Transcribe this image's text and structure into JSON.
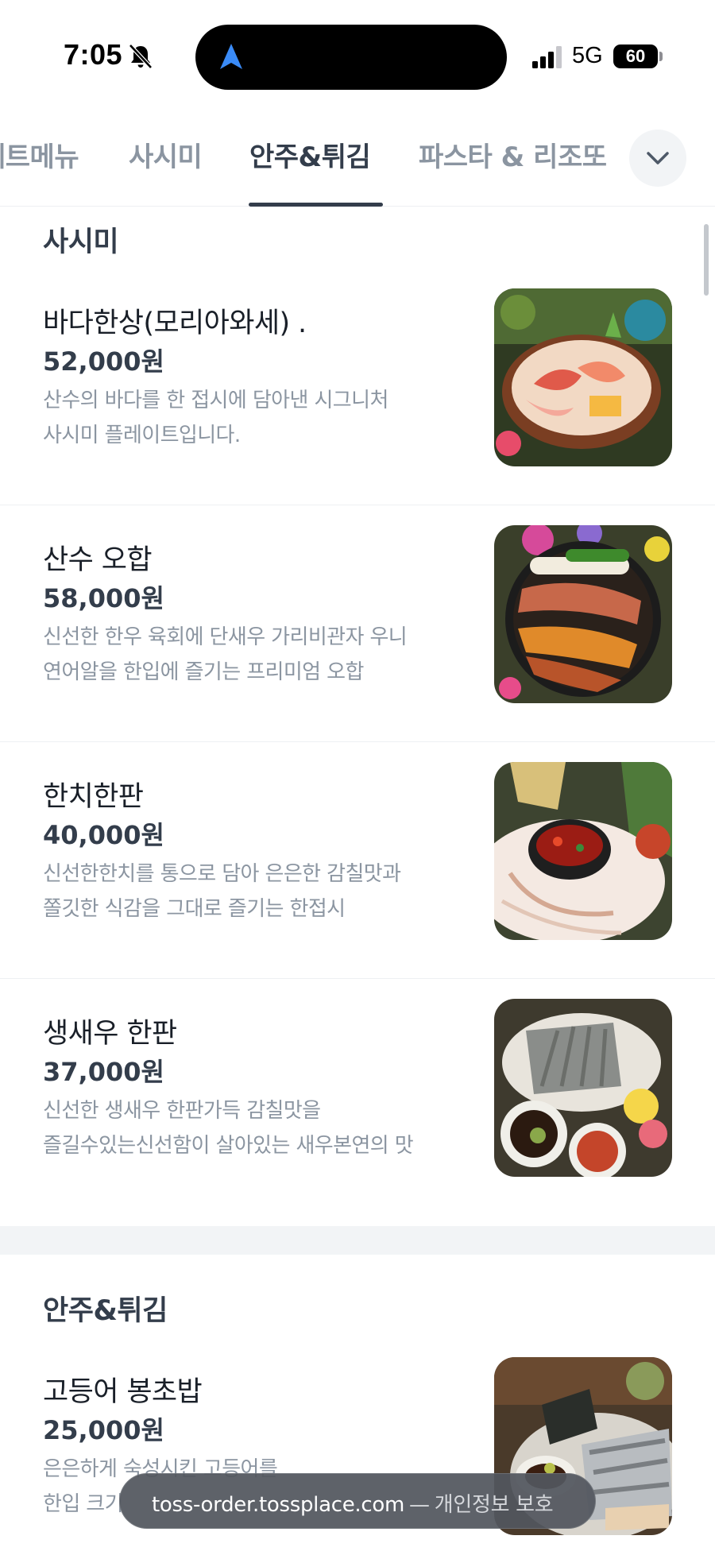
{
  "status_bar": {
    "time": "7:05",
    "network": "5G",
    "battery": "60",
    "icons": [
      "bell-slash-icon",
      "navigation-arrow-icon",
      "signal-icon",
      "battery-icon"
    ]
  },
  "tabs": {
    "items": [
      {
        "label": "세트메뉴",
        "active": false
      },
      {
        "label": "사시미",
        "active": false
      },
      {
        "label": "안주&튀김",
        "active": true
      },
      {
        "label": "파스타 & 리조또",
        "active": false
      }
    ],
    "expand_icon": "chevron-down-icon"
  },
  "sections": [
    {
      "title": "사시미",
      "items": [
        {
          "name": "바다한상(모리아와세) .",
          "price": "52,000원",
          "desc_line1": "산수의 바다를 한 접시에 담아낸 시그니처",
          "desc_line2": "사시미 플레이트입니다."
        },
        {
          "name": "산수 오합",
          "price": "58,000원",
          "desc_line1": "신선한 한우 육회에 단새우 가리비관자 우니",
          "desc_line2": "연어알을 한입에 즐기는 프리미엄 오합"
        },
        {
          "name": "한치한판",
          "price": "40,000원",
          "desc_line1": "신선한한치를 통으로 담아 은은한 감칠맛과",
          "desc_line2": "쫄깃한 식감을 그대로 즐기는 한접시"
        },
        {
          "name": "생새우 한판",
          "price": "37,000원",
          "desc_line1": "신선한 생새우 한판가득 감칠맛을",
          "desc_line2": "즐길수있는신선함이 살아있는 새우본연의 맛"
        }
      ]
    },
    {
      "title": "안주&튀김",
      "items": [
        {
          "name": "고등어 봉초밥",
          "price": "25,000원",
          "desc_line1": "은은하게 숙성시킨 고등어를",
          "desc_line2": "한입 크기"
        }
      ]
    }
  ],
  "browser": {
    "url": "toss-order.tossplace.com",
    "separator": "—",
    "privacy_label": "개인정보 보호"
  },
  "colors": {
    "text_primary": "#191f28",
    "text_secondary": "#8b95a1",
    "tab_active": "#333d4b",
    "divider": "#f2f4f6",
    "island": "#000000"
  }
}
